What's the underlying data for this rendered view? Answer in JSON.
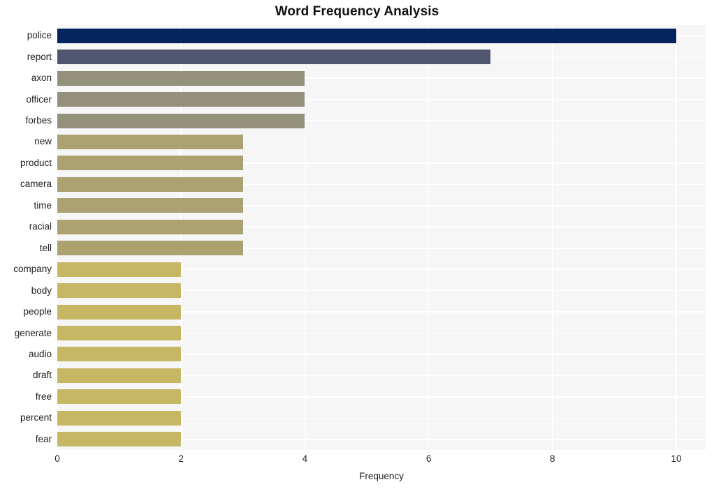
{
  "chart_data": {
    "type": "bar",
    "orientation": "horizontal",
    "title": "Word Frequency Analysis",
    "xlabel": "Frequency",
    "ylabel": "",
    "xlim": [
      0,
      10
    ],
    "ylim": [
      0,
      20
    ],
    "grid": true,
    "legend": false,
    "xticks": [
      "0",
      "2",
      "4",
      "6",
      "8",
      "10"
    ],
    "xtick_values": [
      0,
      2,
      4,
      6,
      8,
      10
    ],
    "categories": [
      "police",
      "report",
      "axon",
      "officer",
      "forbes",
      "new",
      "product",
      "camera",
      "time",
      "racial",
      "tell",
      "company",
      "body",
      "people",
      "generate",
      "audio",
      "draft",
      "free",
      "percent",
      "fear"
    ],
    "values": [
      10,
      7,
      4,
      4,
      4,
      3,
      3,
      3,
      3,
      3,
      3,
      2,
      2,
      2,
      2,
      2,
      2,
      2,
      2,
      2
    ],
    "bar_colors": [
      "#03245c",
      "#4f566d",
      "#93907c",
      "#93907c",
      "#93907c",
      "#aca271",
      "#aca271",
      "#aca271",
      "#aca271",
      "#aca271",
      "#aca271",
      "#c5b763",
      "#c5b763",
      "#c5b763",
      "#c5b763",
      "#c5b763",
      "#c5b763",
      "#c5b763",
      "#c5b763",
      "#c5b763"
    ]
  },
  "style": {
    "plot_background": "#f6f6f7",
    "figure_background": "#ffffff",
    "gridline_color": "#ffffff",
    "text_color": "#222222",
    "title_color": "#111111"
  }
}
